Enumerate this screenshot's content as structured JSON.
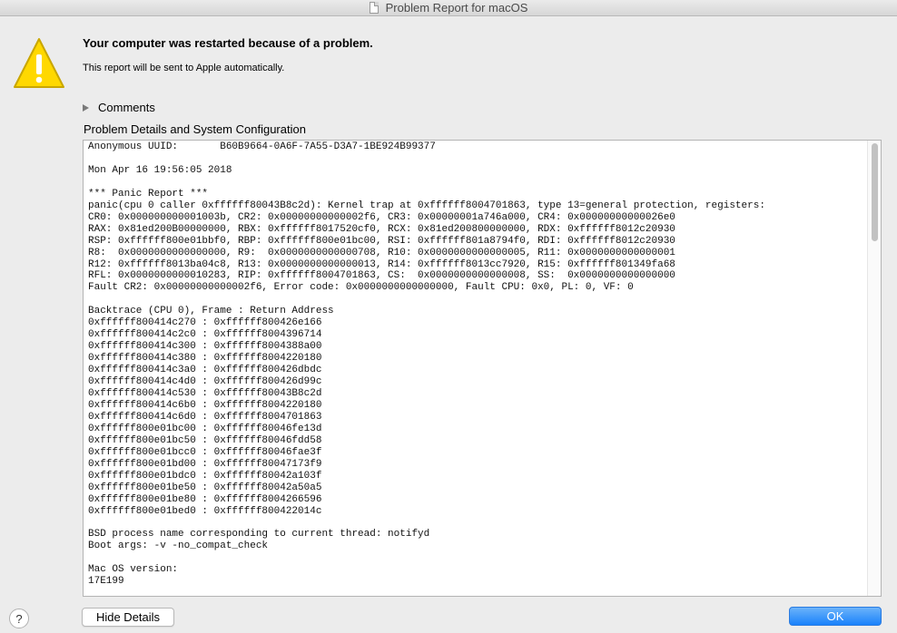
{
  "window": {
    "title": "Problem Report for macOS"
  },
  "header": {
    "headline": "Your computer was restarted because of a problem.",
    "subline": "This report will be sent to Apple automatically."
  },
  "comments": {
    "label": "Comments"
  },
  "details": {
    "title": "Problem Details and System Configuration",
    "report_text": "Anonymous UUID:       B60B9664-0A6F-7A55-D3A7-1BE924B99377\n\nMon Apr 16 19:56:05 2018\n\n*** Panic Report ***\npanic(cpu 0 caller 0xffffff80043B8c2d): Kernel trap at 0xffffff8004701863, type 13=general protection, registers:\nCR0: 0x000000000001003b, CR2: 0x00000000000002f6, CR3: 0x00000001a746a000, CR4: 0x00000000000026e0\nRAX: 0x81ed200B00000000, RBX: 0xffffff8017520cf0, RCX: 0x81ed200800000000, RDX: 0xffffff8012c20930\nRSP: 0xffffff800e01bbf0, RBP: 0xffffff800e01bc00, RSI: 0xffffff801a8794f0, RDI: 0xffffff8012c20930\nR8:  0x0000000000000000, R9:  0x0000000000000708, R10: 0x0000000000000005, R11: 0x0000000000000001\nR12: 0xffffff8013ba04c8, R13: 0x0000000000000013, R14: 0xffffff8013cc7920, R15: 0xffffff801349fa68\nRFL: 0x0000000000010283, RIP: 0xffffff8004701863, CS:  0x0000000000000008, SS:  0x0000000000000000\nFault CR2: 0x00000000000002f6, Error code: 0x0000000000000000, Fault CPU: 0x0, PL: 0, VF: 0\n\nBacktrace (CPU 0), Frame : Return Address\n0xffffff800414c270 : 0xffffff800426e166\n0xffffff800414c2c0 : 0xffffff8004396714\n0xffffff800414c300 : 0xffffff8004388a00\n0xffffff800414c380 : 0xffffff8004220180\n0xffffff800414c3a0 : 0xffffff800426dbdc\n0xffffff800414c4d0 : 0xffffff800426d99c\n0xffffff800414c530 : 0xffffff80043B8c2d\n0xffffff800414c6b0 : 0xffffff8004220180\n0xffffff800414c6d0 : 0xffffff8004701863\n0xffffff800e01bc00 : 0xffffff80046fe13d\n0xffffff800e01bc50 : 0xffffff80046fdd58\n0xffffff800e01bcc0 : 0xffffff80046fae3f\n0xffffff800e01bd00 : 0xffffff80047173f9\n0xffffff800e01bdc0 : 0xffffff80042a103f\n0xffffff800e01be50 : 0xffffff80042a50a5\n0xffffff800e01be80 : 0xffffff8004266596\n0xffffff800e01bed0 : 0xffffff800422014c\n\nBSD process name corresponding to current thread: notifyd\nBoot args: -v -no_compat_check\n\nMac OS version:\n17E199"
  },
  "footer": {
    "help_label": "?",
    "hide_details_label": "Hide Details",
    "ok_label": "OK"
  },
  "colors": {
    "accent": "#1a82fb",
    "warning_fill": "#ffd800",
    "window_bg": "#ececec"
  },
  "icons": {
    "warning": "warning-triangle-icon",
    "document": "document-icon",
    "disclosure": "disclosure-triangle-icon"
  }
}
